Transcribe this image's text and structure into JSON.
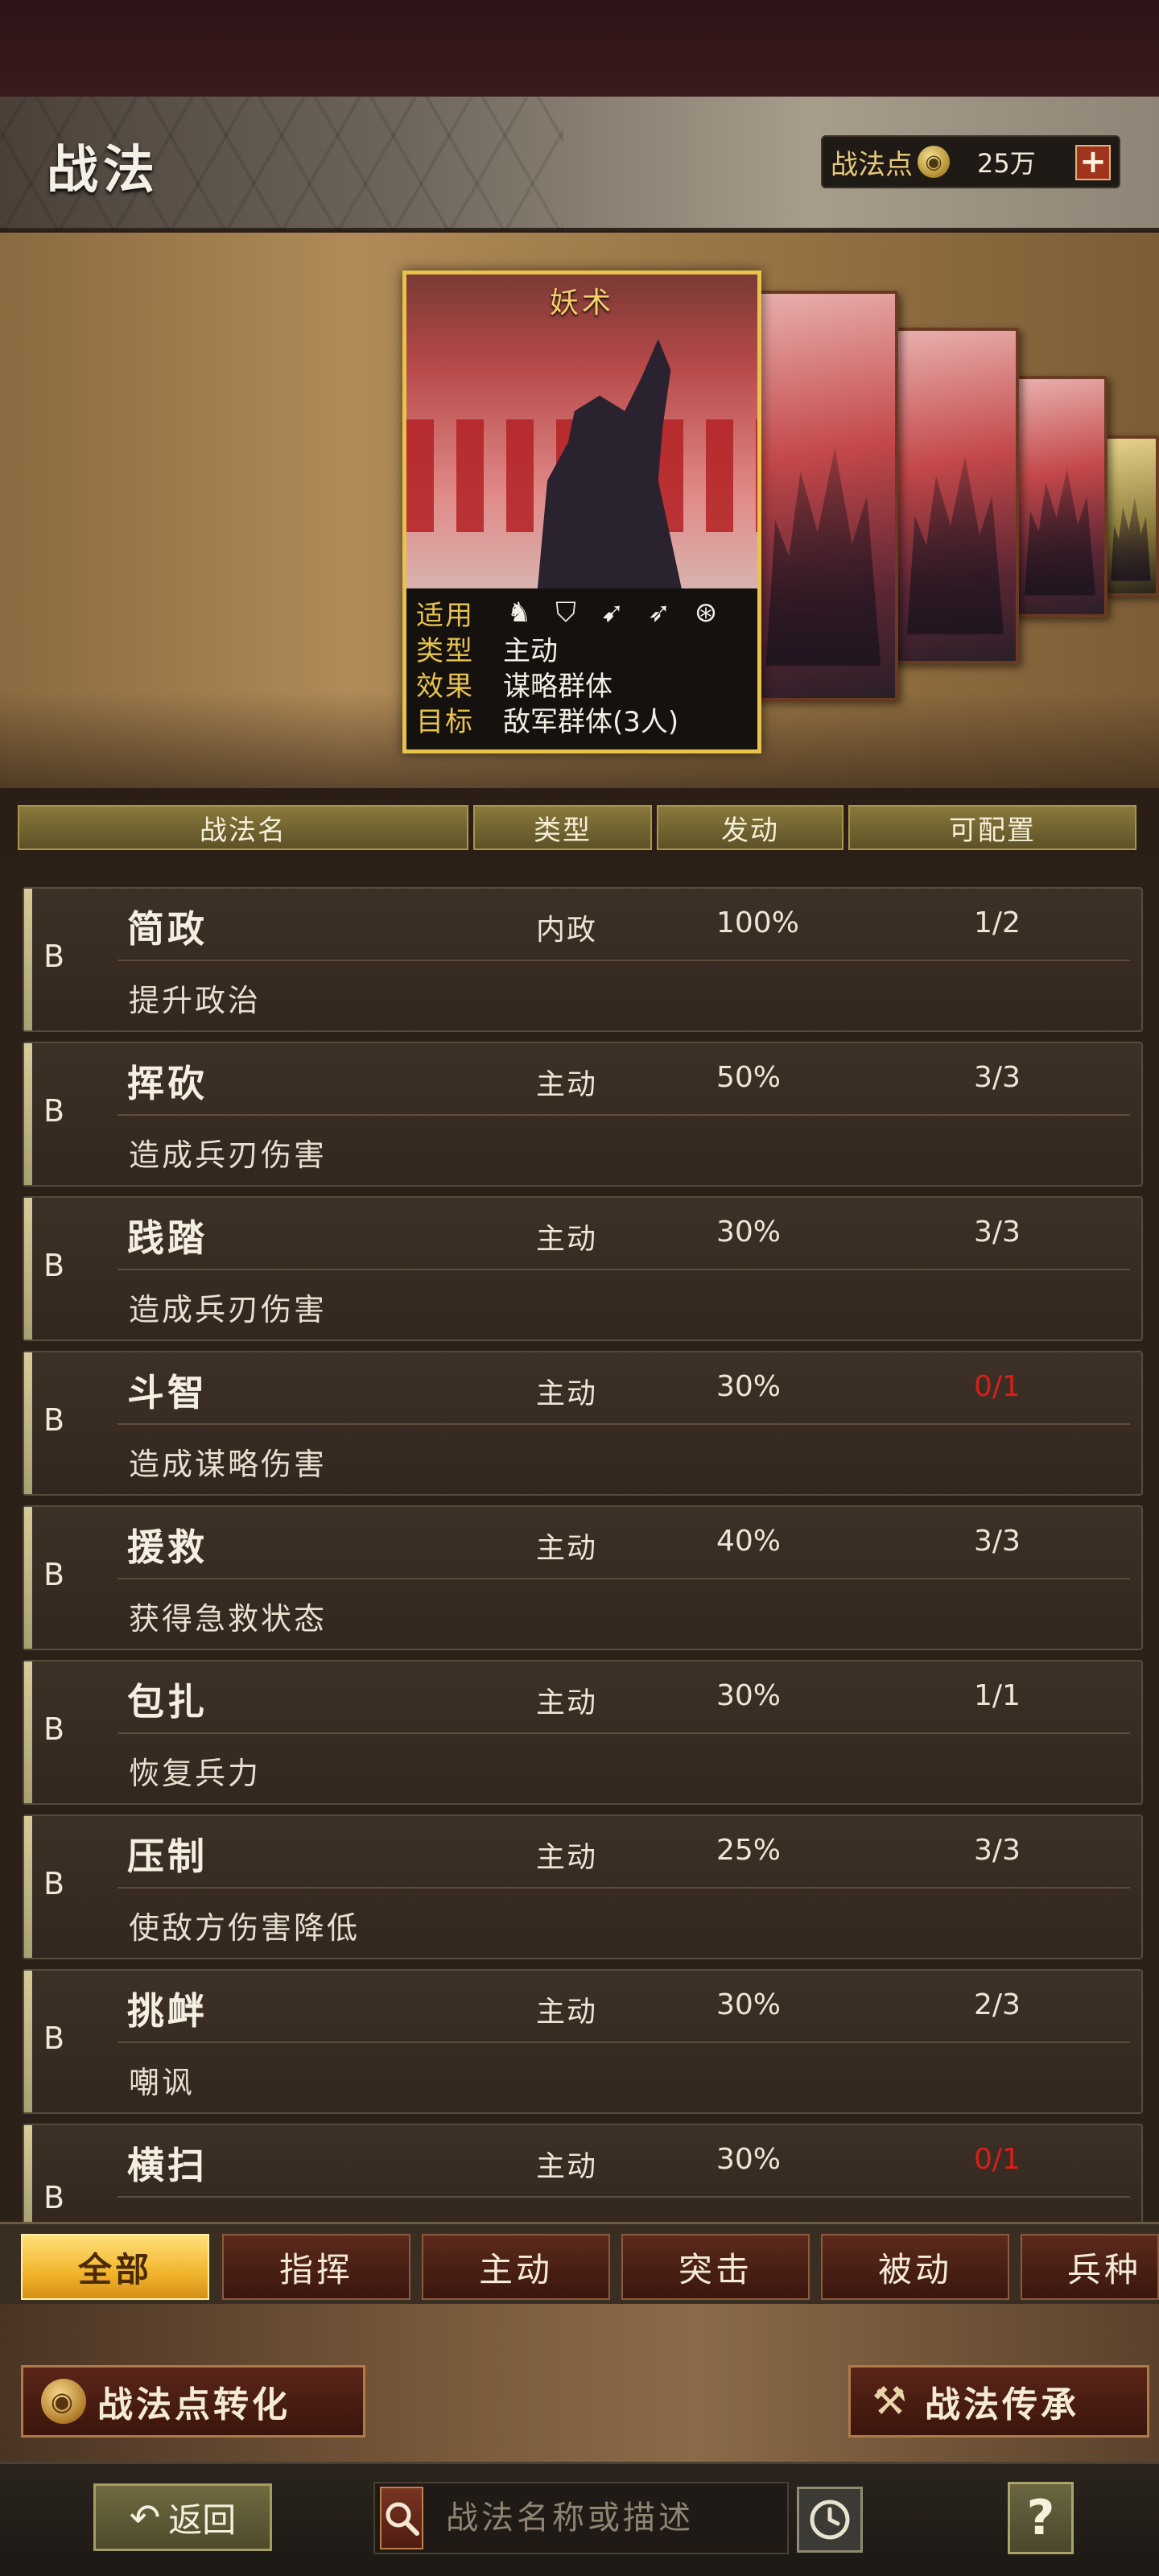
{
  "header": {
    "title": "战法",
    "points_label": "战法点",
    "points_value": "25万",
    "plus_label": "+"
  },
  "featured_card": {
    "name": "妖术",
    "rows": [
      {
        "key": "适用",
        "value": ""
      },
      {
        "key": "类型",
        "value": "主动"
      },
      {
        "key": "效果",
        "value": "谋略群体"
      },
      {
        "key": "目标",
        "value": "敌军群体(3人)"
      }
    ],
    "apply_icons": [
      "cavalry-icon",
      "shield-icon",
      "bow-icon",
      "spear-icon",
      "siege-wheel-icon"
    ]
  },
  "table": {
    "headers": [
      "战法名",
      "类型",
      "发动",
      "可配置"
    ],
    "rows": [
      {
        "grade": "B",
        "name": "简政",
        "type": "内政",
        "rate": "100%",
        "count": "1/2",
        "desc": "提升政治",
        "count_color": "normal"
      },
      {
        "grade": "B",
        "name": "挥砍",
        "type": "主动",
        "rate": "50%",
        "count": "3/3",
        "desc": "造成兵刃伤害",
        "count_color": "normal"
      },
      {
        "grade": "B",
        "name": "践踏",
        "type": "主动",
        "rate": "30%",
        "count": "3/3",
        "desc": "造成兵刃伤害",
        "count_color": "normal"
      },
      {
        "grade": "B",
        "name": "斗智",
        "type": "主动",
        "rate": "30%",
        "count": "0/1",
        "desc": "造成谋略伤害",
        "count_color": "red"
      },
      {
        "grade": "B",
        "name": "援救",
        "type": "主动",
        "rate": "40%",
        "count": "3/3",
        "desc": "获得急救状态",
        "count_color": "normal"
      },
      {
        "grade": "B",
        "name": "包扎",
        "type": "主动",
        "rate": "30%",
        "count": "1/1",
        "desc": "恢复兵力",
        "count_color": "normal"
      },
      {
        "grade": "B",
        "name": "压制",
        "type": "主动",
        "rate": "25%",
        "count": "3/3",
        "desc": "使敌方伤害降低",
        "count_color": "normal"
      },
      {
        "grade": "B",
        "name": "挑衅",
        "type": "主动",
        "rate": "30%",
        "count": "2/3",
        "desc": "嘲讽",
        "count_color": "normal"
      },
      {
        "grade": "B",
        "name": "横扫",
        "type": "主动",
        "rate": "30%",
        "count": "0/1",
        "desc": "",
        "count_color": "red"
      }
    ]
  },
  "filter_tabs": [
    "全部",
    "指挥",
    "主动",
    "突击",
    "被动",
    "兵种"
  ],
  "actions": {
    "convert_label": "战法点转化",
    "inherit_label": "战法传承"
  },
  "bottom_bar": {
    "back_label": "返回",
    "search_placeholder": "战法名称或描述",
    "help_label": "?"
  },
  "colors": {
    "gold": "#e9c24b",
    "red_count": "#d4201a"
  }
}
